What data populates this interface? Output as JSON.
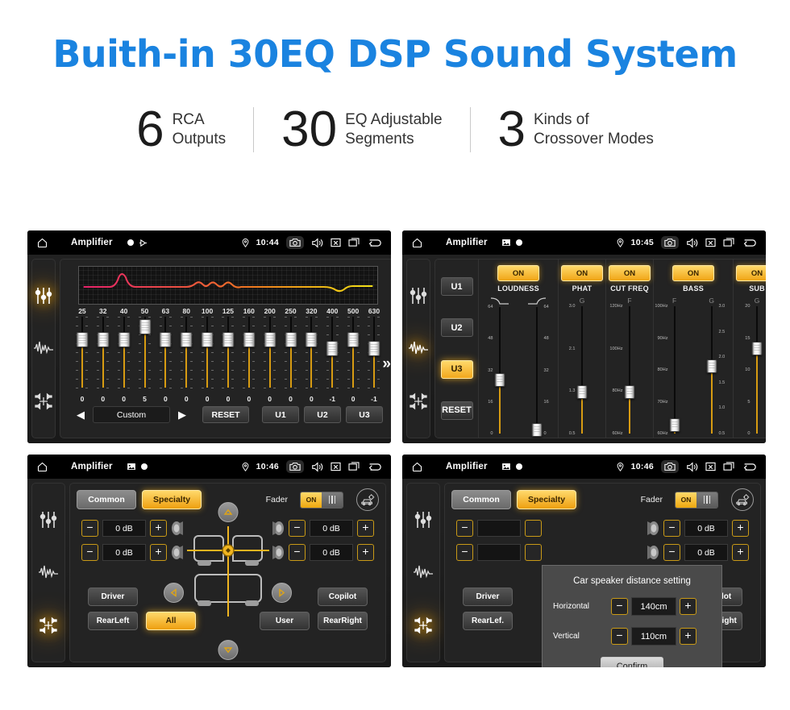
{
  "header": {
    "title": "Buith-in 30EQ DSP Sound System",
    "title_color": "#1a83e0",
    "stats": [
      {
        "number": "6",
        "line1": "RCA",
        "line2": "Outputs"
      },
      {
        "number": "30",
        "line1": "EQ Adjustable",
        "line2": "Segments"
      },
      {
        "number": "3",
        "line1": "Kinds of",
        "line2": "Crossover Modes"
      }
    ]
  },
  "accent": {
    "orange": "#f0a516",
    "track": "#d79b12",
    "blue": "#1a83e0"
  },
  "screens": [
    {
      "id": "eq-screen",
      "statusbar": {
        "app_title": "Amplifier",
        "time": "10:44",
        "icons": [
          "home-icon",
          "record-dot-icon",
          "play-icon",
          "location-pin-icon",
          "camera-icon",
          "volume-icon",
          "close-box-icon",
          "recent-apps-icon",
          "back-arrow-icon"
        ]
      },
      "rail": [
        {
          "name": "equalizer-icon",
          "active": true
        },
        {
          "name": "waveform-icon",
          "active": false
        },
        {
          "name": "balance-icon",
          "active": false
        }
      ],
      "eq": {
        "frequencies": [
          "25",
          "32",
          "40",
          "50",
          "63",
          "80",
          "100",
          "125",
          "160",
          "200",
          "250",
          "320",
          "400",
          "500",
          "630"
        ],
        "values": [
          "0",
          "0",
          "0",
          "5",
          "0",
          "0",
          "0",
          "0",
          "0",
          "0",
          "0",
          "0",
          "-1",
          "0",
          "-1"
        ],
        "more_label": "»",
        "preset": "Custom",
        "prev_label": "◀",
        "next_label": "▶",
        "reset_label": "RESET",
        "user_presets": [
          "U1",
          "U2",
          "U3"
        ]
      }
    },
    {
      "id": "adv-screen",
      "statusbar": {
        "app_title": "Amplifier",
        "time": "10:45",
        "icons": [
          "home-icon",
          "image-icon",
          "record-dot-icon",
          "location-pin-icon",
          "camera-icon",
          "volume-icon",
          "close-box-icon",
          "recent-apps-icon",
          "back-arrow-icon"
        ]
      },
      "rail": [
        {
          "name": "equalizer-icon",
          "active": false
        },
        {
          "name": "waveform-icon",
          "active": true
        },
        {
          "name": "balance-icon",
          "active": false
        }
      ],
      "presets": {
        "items": [
          "U1",
          "U2",
          "U3"
        ],
        "selected": "U3",
        "reset_label": "RESET"
      },
      "modules": [
        {
          "name": "LOUDNESS",
          "state": "ON",
          "sub_labels": [],
          "sliders": [
            {
              "scale_side": "left",
              "ticks": [
                "64",
                "48",
                "32",
                "16",
                "0"
              ],
              "knob_pct": 52
            },
            {
              "scale_side": "right",
              "ticks": [
                "64",
                "48",
                "32",
                "16",
                "0"
              ],
              "knob_pct": 92
            }
          ]
        },
        {
          "name": "PHAT",
          "state": "ON",
          "sub_labels": [
            "G"
          ],
          "sliders": [
            {
              "scale_side": "left",
              "ticks": [
                "3.0",
                "2.1",
                "1.3",
                "0.5"
              ],
              "knob_pct": 62
            }
          ]
        },
        {
          "name": "CUT FREQ",
          "state": "ON",
          "sub_labels": [
            "F"
          ],
          "sliders": [
            {
              "scale_side": "left",
              "ticks": [
                "120Hz",
                "100Hz",
                "80Hz",
                "60Hz"
              ],
              "knob_pct": 62
            }
          ]
        },
        {
          "name": "BASS",
          "state": "ON",
          "sub_labels": [
            "F",
            "G"
          ],
          "sliders": [
            {
              "scale_side": "left",
              "ticks": [
                "100Hz",
                "90Hz",
                "80Hz",
                "70Hz",
                "60Hz"
              ],
              "knob_pct": 88
            },
            {
              "scale_side": "right",
              "ticks": [
                "3.0",
                "2.5",
                "2.0",
                "1.5",
                "1.0",
                "0.5"
              ],
              "knob_pct": 42
            }
          ]
        },
        {
          "name": "SUB",
          "state": "ON",
          "sub_labels": [
            "G"
          ],
          "sliders": [
            {
              "scale_side": "left",
              "ticks": [
                "20",
                "15",
                "10",
                "5",
                "0"
              ],
              "knob_pct": 28
            }
          ]
        }
      ]
    },
    {
      "id": "fader-screen",
      "statusbar": {
        "app_title": "Amplifier",
        "time": "10:46",
        "icons": [
          "home-icon",
          "image-icon",
          "record-dot-icon",
          "location-pin-icon",
          "camera-icon",
          "volume-icon",
          "close-box-icon",
          "recent-apps-icon",
          "back-arrow-icon"
        ]
      },
      "rail": [
        {
          "name": "equalizer-icon",
          "active": false
        },
        {
          "name": "waveform-icon",
          "active": false
        },
        {
          "name": "balance-icon",
          "active": true
        }
      ],
      "tabs": [
        {
          "label": "Common",
          "active": false
        },
        {
          "label": "Specialty",
          "active": true
        }
      ],
      "fader": {
        "label": "Fader",
        "toggle_state": "ON",
        "gear_icon": "car-settings-icon",
        "levels": [
          {
            "position": "front-left",
            "value": "0 dB"
          },
          {
            "position": "rear-left",
            "value": "0 dB"
          },
          {
            "position": "front-right",
            "value": "0 dB"
          },
          {
            "position": "rear-right",
            "value": "0 dB"
          }
        ],
        "minus_label": "−",
        "plus_label": "+",
        "seat_buttons": [
          {
            "label": "Driver",
            "active": false
          },
          {
            "label": "Copilot",
            "active": false
          },
          {
            "label": "RearLeft",
            "active": false
          },
          {
            "label": "All",
            "active": true
          },
          {
            "label": "User",
            "active": false
          },
          {
            "label": "RearRight",
            "active": false
          }
        ],
        "nudge_arrows": [
          "up-arrow-icon",
          "down-arrow-icon",
          "left-arrow-icon",
          "right-arrow-icon"
        ]
      },
      "dialog": null
    },
    {
      "id": "fader-dialog-screen",
      "statusbar": {
        "app_title": "Amplifier",
        "time": "10:46",
        "icons": [
          "home-icon",
          "image-icon",
          "record-dot-icon",
          "location-pin-icon",
          "camera-icon",
          "volume-icon",
          "close-box-icon",
          "recent-apps-icon",
          "back-arrow-icon"
        ]
      },
      "rail": [
        {
          "name": "equalizer-icon",
          "active": false
        },
        {
          "name": "waveform-icon",
          "active": false
        },
        {
          "name": "balance-icon",
          "active": true
        }
      ],
      "tabs": [
        {
          "label": "Common",
          "active": false
        },
        {
          "label": "Specialty",
          "active": true
        }
      ],
      "fader": {
        "label": "Fader",
        "toggle_state": "ON",
        "gear_icon": "car-settings-icon",
        "levels": [
          {
            "position": "front-right",
            "value": "0 dB"
          },
          {
            "position": "rear-right",
            "value": "0 dB"
          }
        ],
        "minus_label": "−",
        "plus_label": "+",
        "seat_buttons": [
          {
            "label": "Driver",
            "active": false
          },
          {
            "label": "Copilot",
            "active": false
          },
          {
            "label": "RearLef.",
            "active": false
          },
          {
            "label": "RearRight",
            "active": false
          }
        ]
      },
      "dialog": {
        "title": "Car speaker distance setting",
        "rows": [
          {
            "label": "Horizontal",
            "value": "140cm"
          },
          {
            "label": "Vertical",
            "value": "110cm"
          }
        ],
        "minus_label": "−",
        "plus_label": "+",
        "confirm_label": "Confirm"
      }
    }
  ],
  "eq_curve": {
    "description": "equalizer response curve, pink-to-yellow gradient",
    "colors": [
      "#e8226b",
      "#f07820",
      "#f2e017"
    ]
  }
}
